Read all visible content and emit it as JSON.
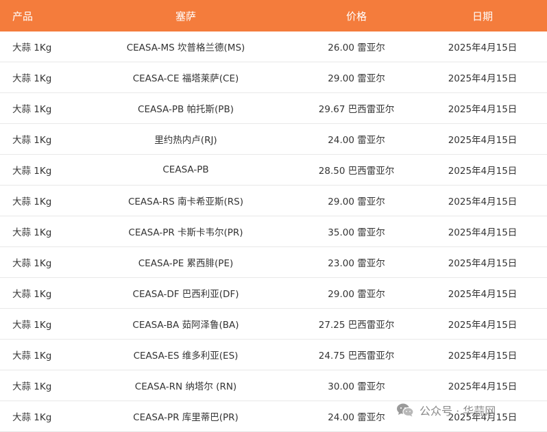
{
  "header": {
    "product": "产品",
    "market": "塞萨",
    "price": "价格",
    "date": "日期"
  },
  "rows": [
    {
      "product": "大蒜 1Kg",
      "market": "CEASA-MS 坎普格兰德(MS)",
      "price": "26.00 雷亚尔",
      "date": "2025年4月15日"
    },
    {
      "product": "大蒜 1Kg",
      "market": "CEASA-CE 福塔莱萨(CE)",
      "price": "29.00 雷亚尔",
      "date": "2025年4月15日"
    },
    {
      "product": "大蒜 1Kg",
      "market": "CEASA-PB 帕托斯(PB)",
      "price": "29.67 巴西雷亚尔",
      "date": "2025年4月15日"
    },
    {
      "product": "大蒜 1Kg",
      "market": "里约热内卢(RJ)",
      "price": "24.00 雷亚尔",
      "date": "2025年4月15日"
    },
    {
      "product": "大蒜 1Kg",
      "market": "CEASA-PB",
      "price": "28.50 巴西雷亚尔",
      "date": "2025年4月15日"
    },
    {
      "product": "大蒜 1Kg",
      "market": "CEASA-RS 南卡希亚斯(RS)",
      "price": "29.00 雷亚尔",
      "date": "2025年4月15日"
    },
    {
      "product": "大蒜 1Kg",
      "market": "CEASA-PR 卡斯卡韦尔(PR)",
      "price": "35.00 雷亚尔",
      "date": "2025年4月15日"
    },
    {
      "product": "大蒜 1Kg",
      "market": "CEASA-PE 累西腓(PE)",
      "price": "23.00 雷亚尔",
      "date": "2025年4月15日"
    },
    {
      "product": "大蒜 1Kg",
      "market": "CEASA-DF 巴西利亚(DF)",
      "price": "29.00 雷亚尔",
      "date": "2025年4月15日"
    },
    {
      "product": "大蒜 1Kg",
      "market": "CEASA-BA 茹阿泽鲁(BA)",
      "price": "27.25 巴西雷亚尔",
      "date": "2025年4月15日"
    },
    {
      "product": "大蒜 1Kg",
      "market": "CEASA-ES 维多利亚(ES)",
      "price": "24.75 巴西雷亚尔",
      "date": "2025年4月15日"
    },
    {
      "product": "大蒜 1Kg",
      "market": "CEASA-RN 纳塔尔 (RN)",
      "price": "30.00 雷亚尔",
      "date": "2025年4月15日"
    },
    {
      "product": "大蒜 1Kg",
      "market": "CEASA-PR 库里蒂巴(PR)",
      "price": "24.00 雷亚尔",
      "date": "2025年4月15日"
    }
  ],
  "watermark": {
    "text": "公众号 · 华蒜网",
    "icon": "wechat-icon"
  },
  "colors": {
    "header_background": "#f47c3c",
    "header_text": "#ffffff",
    "row_divider": "#e8e8e8"
  }
}
